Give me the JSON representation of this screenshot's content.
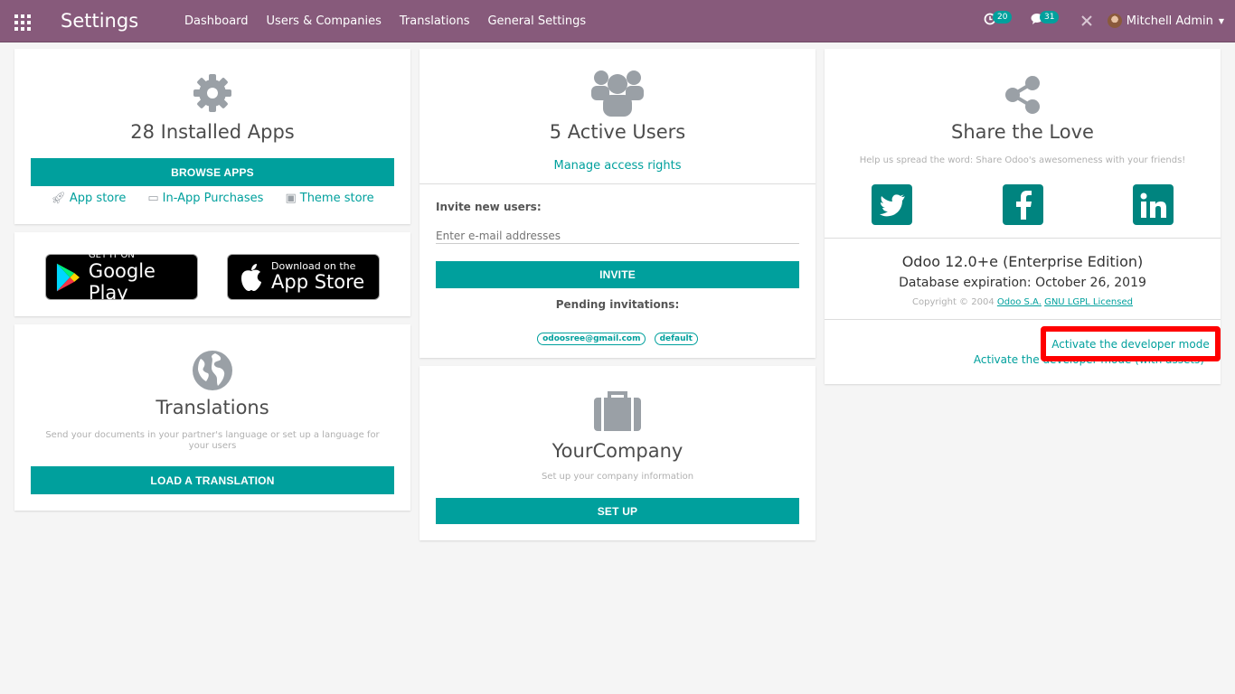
{
  "header": {
    "brand": "Settings",
    "menu": [
      "Dashboard",
      "Users & Companies",
      "Translations",
      "General Settings"
    ],
    "activity_count": "20",
    "messages_count": "31",
    "user_name": "Mitchell Admin"
  },
  "apps_card": {
    "title": "28 Installed Apps",
    "browse_label": "BROWSE APPS",
    "links": [
      "App store",
      "In-App Purchases",
      "Theme store"
    ]
  },
  "stores": {
    "google_small": "GET IT ON",
    "google_big": "Google Play",
    "apple_small": "Download on the",
    "apple_big": "App Store"
  },
  "translations_card": {
    "title": "Translations",
    "description": "Send your documents in your partner's language or set up a language for your users",
    "button": "LOAD A TRANSLATION"
  },
  "users_card": {
    "title": "5 Active Users",
    "manage_link": "Manage access rights",
    "invite_label": "Invite new users:",
    "email_placeholder": "Enter e-mail addresses",
    "invite_button": "INVITE",
    "pending_label": "Pending invitations:",
    "pending": [
      "odoosree@gmail.com",
      "default"
    ]
  },
  "company_card": {
    "title": "YourCompany",
    "description": "Set up your company information",
    "button": "SET UP"
  },
  "share_card": {
    "title": "Share the Love",
    "description": "Help us spread the word: Share Odoo's awesomeness with your friends!",
    "version": "Odoo 12.0+e (Enterprise Edition)",
    "expiration": "Database expiration: October 26, 2019",
    "copyright": "Copyright © 2004",
    "company_link": "Odoo S.A.",
    "license_link": "GNU LGPL Licensed",
    "dev_mode": "Activate the developer mode",
    "dev_mode_assets": "Activate the developer mode (with assets)"
  },
  "colors": {
    "navbar": "#875a7b",
    "primary": "#00a09d",
    "highlight": "#ff0000"
  }
}
